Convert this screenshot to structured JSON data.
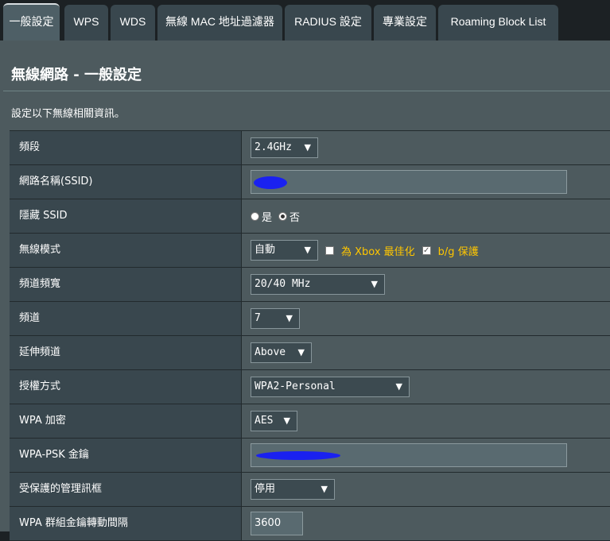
{
  "tabs": [
    {
      "label": "一般設定",
      "active": true
    },
    {
      "label": "WPS"
    },
    {
      "label": "WDS"
    },
    {
      "label": "無線 MAC 地址過濾器"
    },
    {
      "label": "RADIUS 設定"
    },
    {
      "label": "專業設定"
    },
    {
      "label": "Roaming Block List"
    }
  ],
  "page": {
    "title": "無線網路 - 一般設定",
    "description": "設定以下無線相關資訊。"
  },
  "rows": {
    "band": {
      "label": "頻段",
      "value": "2.4GHz"
    },
    "ssid": {
      "label": "網路名稱(SSID)",
      "value": "",
      "redacted": true
    },
    "hide_ssid": {
      "label": "隱藏 SSID",
      "yes": "是",
      "no": "否",
      "selected": "no"
    },
    "wireless_mode": {
      "label": "無線模式",
      "value": "自動",
      "xbox_label": "為 Xbox 最佳化",
      "xbox_checked": false,
      "bg_label": "b/g 保護",
      "bg_checked": true
    },
    "channel_bandwidth": {
      "label": "頻道頻寬",
      "value": "20/40 MHz"
    },
    "channel": {
      "label": "頻道",
      "value": "7"
    },
    "ext_channel": {
      "label": "延伸頻道",
      "value": "Above"
    },
    "auth_method": {
      "label": "授權方式",
      "value": "WPA2-Personal"
    },
    "wpa_encryption": {
      "label": "WPA 加密",
      "value": "AES"
    },
    "wpa_psk": {
      "label": "WPA-PSK 金鑰",
      "value": "",
      "redacted": true
    },
    "pmf": {
      "label": "受保護的管理訊框",
      "value": "停用"
    },
    "group_key_interval": {
      "label": "WPA 群組金鑰轉動間隔",
      "value": "3600"
    }
  },
  "colors": {
    "yellow_text": "#ffc600",
    "redaction": "#1a21f0"
  }
}
